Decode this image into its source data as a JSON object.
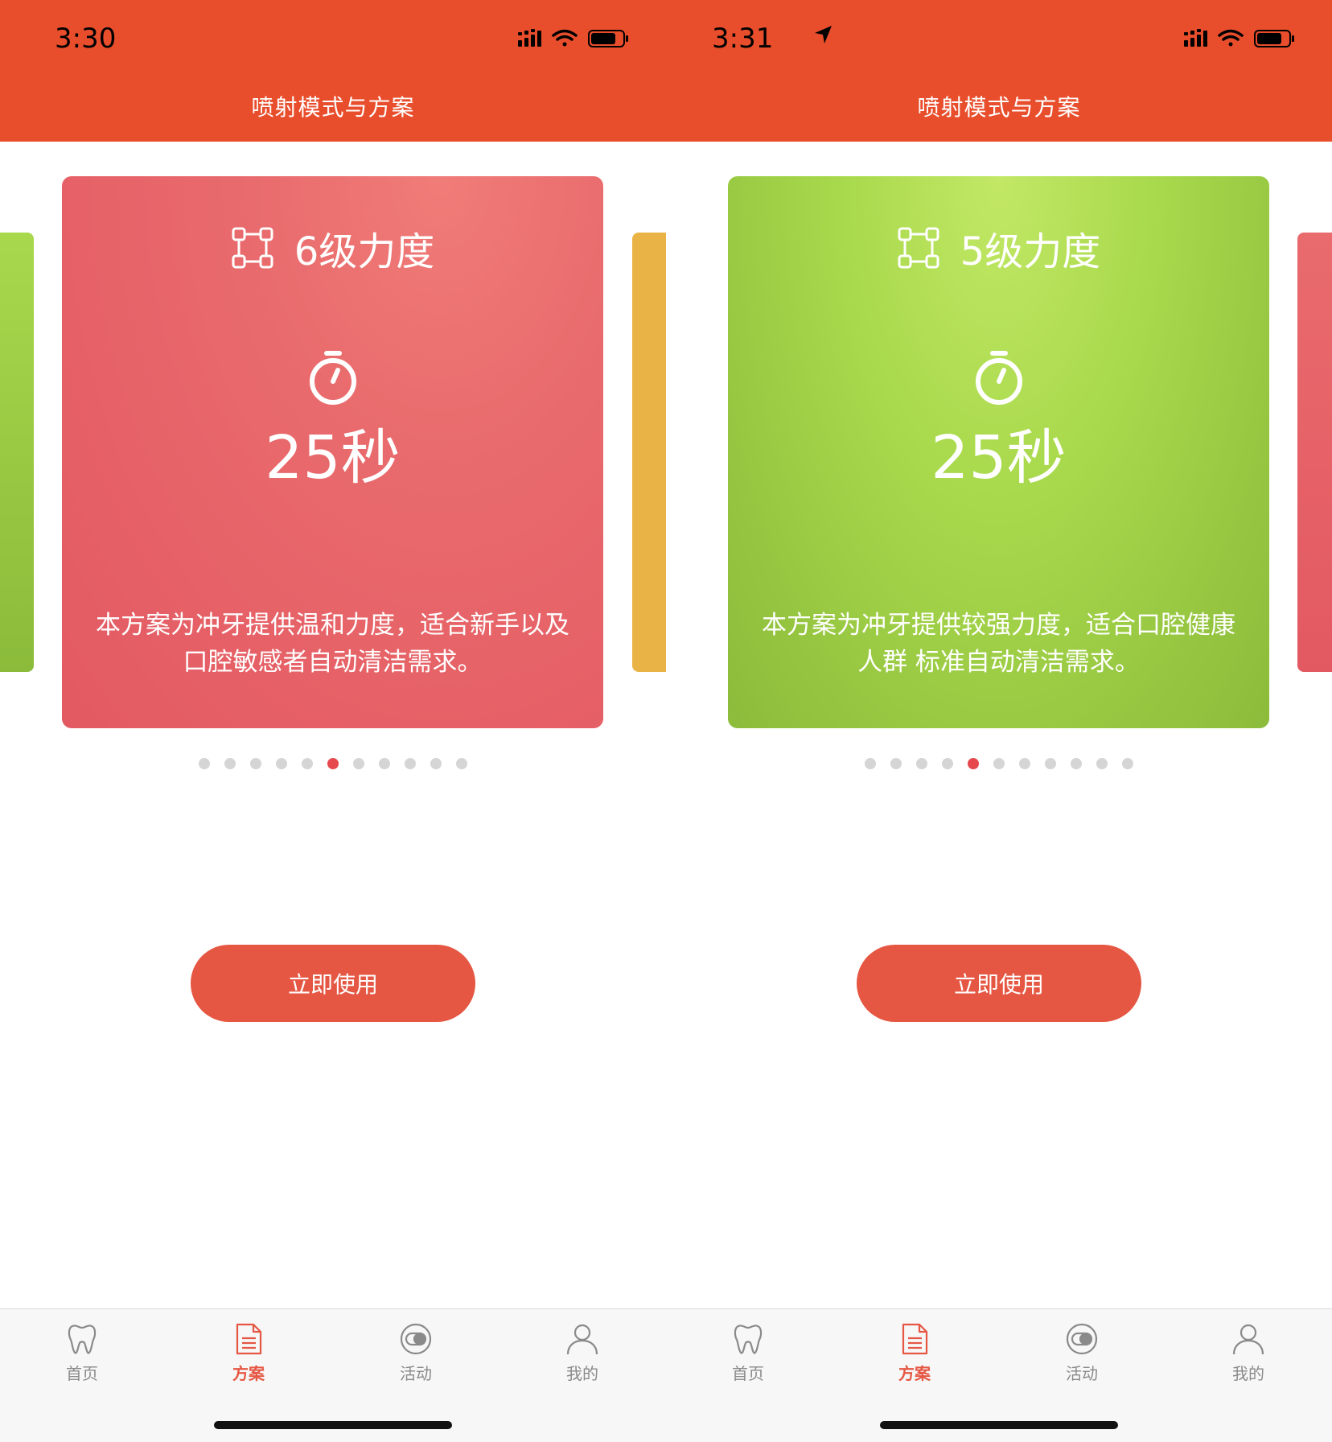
{
  "screens": [
    {
      "status": {
        "time": "3:30"
      },
      "header": {
        "title": "喷射模式与方案"
      },
      "card": {
        "strength": "6级力度",
        "duration": "25秒",
        "description": "本方案为冲牙提供温和力度，适合新手以及口腔敏感者自动清洁需求。",
        "color": "#E8666B"
      },
      "pager": {
        "count": 11,
        "active_index": 5
      },
      "action": {
        "label": "立即使用"
      },
      "tabs": [
        {
          "label": "首页",
          "icon": "tooth-icon"
        },
        {
          "label": "方案",
          "icon": "document-icon",
          "active": true
        },
        {
          "label": "活动",
          "icon": "toggle-icon"
        },
        {
          "label": "我的",
          "icon": "user-icon"
        }
      ]
    },
    {
      "status": {
        "time": "3:31"
      },
      "header": {
        "title": "喷射模式与方案"
      },
      "card": {
        "strength": "5级力度",
        "duration": "25秒",
        "description": "本方案为冲牙提供较强力度，适合口腔健康人群 标准自动清洁需求。",
        "color": "#A3D14A"
      },
      "pager": {
        "count": 11,
        "active_index": 4
      },
      "action": {
        "label": "立即使用"
      },
      "tabs": [
        {
          "label": "首页",
          "icon": "tooth-icon"
        },
        {
          "label": "方案",
          "icon": "document-icon",
          "active": true
        },
        {
          "label": "活动",
          "icon": "toggle-icon"
        },
        {
          "label": "我的",
          "icon": "user-icon"
        }
      ]
    }
  ],
  "colors": {
    "header": "#E84E2C",
    "accent": "#E55743",
    "dot_inactive": "#D5D5D5",
    "dot_active": "#E5484D"
  }
}
